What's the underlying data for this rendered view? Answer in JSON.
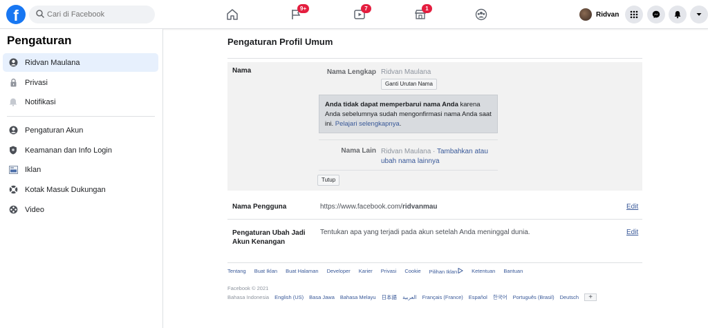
{
  "header": {
    "logo": "f",
    "search_placeholder": "Cari di Facebook",
    "nav": [
      {
        "icon": "home-icon",
        "badge": ""
      },
      {
        "icon": "flag-icon",
        "badge": "9+"
      },
      {
        "icon": "video-icon",
        "badge": "7"
      },
      {
        "icon": "marketplace-icon",
        "badge": "1"
      },
      {
        "icon": "groups-icon",
        "badge": ""
      }
    ],
    "profile_name": "Ridvan",
    "right_icons": [
      "menu-grid-icon",
      "messenger-icon",
      "notifications-bell-icon",
      "account-chevron-icon"
    ]
  },
  "sidebar": {
    "title": "Pengaturan",
    "items": [
      {
        "label": "Ridvan Maulana",
        "icon": "user-profile-icon",
        "active": true
      },
      {
        "label": "Privasi",
        "icon": "privacy-lock-icon"
      },
      {
        "label": "Notifikasi",
        "icon": "notification-bell-icon"
      },
      {
        "label": "Pengaturan Akun",
        "icon": "account-settings-icon"
      },
      {
        "label": "Keamanan dan Info Login",
        "icon": "security-shield-icon"
      },
      {
        "label": "Iklan",
        "icon": "ads-icon"
      },
      {
        "label": "Kotak Masuk Dukungan",
        "icon": "support-lifebuoy-icon"
      },
      {
        "label": "Video",
        "icon": "video-film-icon"
      }
    ]
  },
  "main": {
    "title": "Pengaturan Profil Umum",
    "nama": {
      "section_label": "Nama",
      "full_name_label": "Nama Lengkap",
      "full_name_value": "Ridvan Maulana",
      "change_order_button": "Ganti Urutan Nama",
      "notice_bold": "Anda tidak dapat memperbarui nama Anda",
      "notice_text": " karena Anda sebelumnya sudah mengonfirmasi nama Anda saat ini. ",
      "notice_link": "Pelajari selengkapnya",
      "notice_end": ".",
      "other_name_label": "Nama Lain",
      "other_name_value": "Ridvan Maulana · ",
      "other_name_link": "Tambahkan atau ubah nama lainnya",
      "close_button": "Tutup"
    },
    "username": {
      "label": "Nama Pengguna",
      "value_prefix": "https://www.facebook.com/",
      "value_bold": "ridvanmau",
      "edit": "Edit"
    },
    "memorial": {
      "label": "Pengaturan Ubah Jadi Akun Kenangan",
      "value": "Tentukan apa yang terjadi pada akun setelah Anda meninggal dunia.",
      "edit": "Edit"
    }
  },
  "footer": {
    "links": [
      "Tentang",
      "Buat Iklan",
      "Buat Halaman",
      "Developer",
      "Karier",
      "Privasi",
      "Cookie",
      "Pilihan Iklan",
      "Ketentuan",
      "Bantuan"
    ],
    "copyright": "Facebook © 2021",
    "current_language": "Bahasa Indonesia",
    "languages": [
      "English (US)",
      "Basa Jawa",
      "Bahasa Melayu",
      "日本語",
      "العربية",
      "Français (France)",
      "Español",
      "한국어",
      "Português (Brasil)",
      "Deutsch"
    ],
    "more_languages": "+"
  },
  "colors": {
    "brand": "#1877f2",
    "link": "#385898",
    "badge": "#e41e3f",
    "active_bg": "#e7f0fd"
  }
}
